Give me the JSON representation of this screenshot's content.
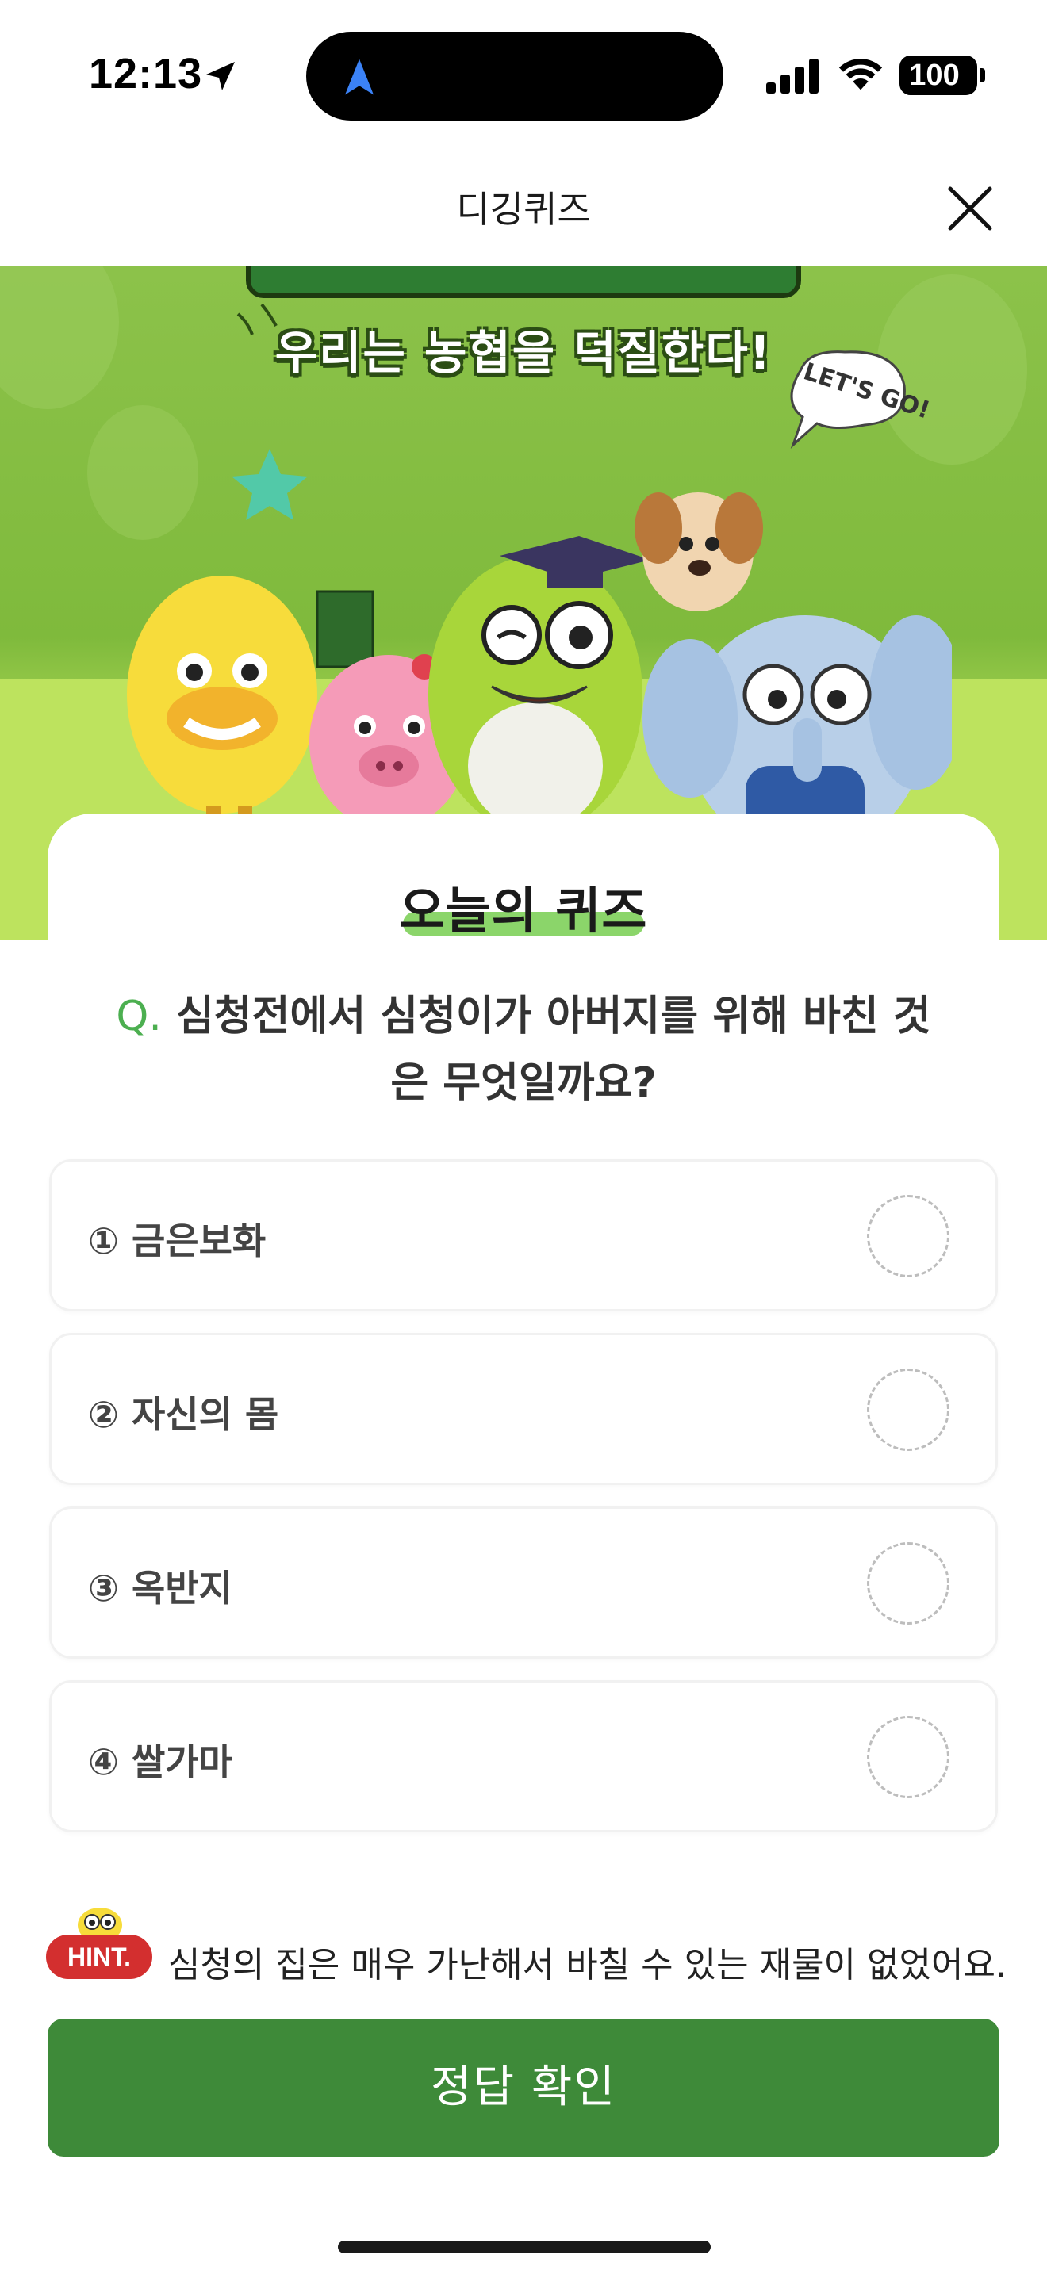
{
  "status_bar": {
    "time": "12:13",
    "battery": "100"
  },
  "header": {
    "title": "디깅퀴즈"
  },
  "banner": {
    "slogan": "우리는 농협을 덕질한다!",
    "bubble_text": "LET'S GO!"
  },
  "quiz": {
    "title": "오늘의 퀴즈",
    "question_prefix": "Q.",
    "question": "심청전에서 심청이가 아버지를 위해 바친 것은 무엇일까요?",
    "options": [
      {
        "label": "① 금은보화"
      },
      {
        "label": "② 자신의 몸"
      },
      {
        "label": "③ 옥반지"
      },
      {
        "label": "④ 쌀가마"
      }
    ]
  },
  "hint": {
    "badge": "HINT.",
    "text": "심청의 집은 매우 가난해서 바칠 수 있는 재물이 없었어요."
  },
  "submit": {
    "label": "정답 확인"
  },
  "colors": {
    "accent_green": "#3e8a39",
    "banner_green": "#8cc24a",
    "hint_red": "#d32f2f"
  }
}
